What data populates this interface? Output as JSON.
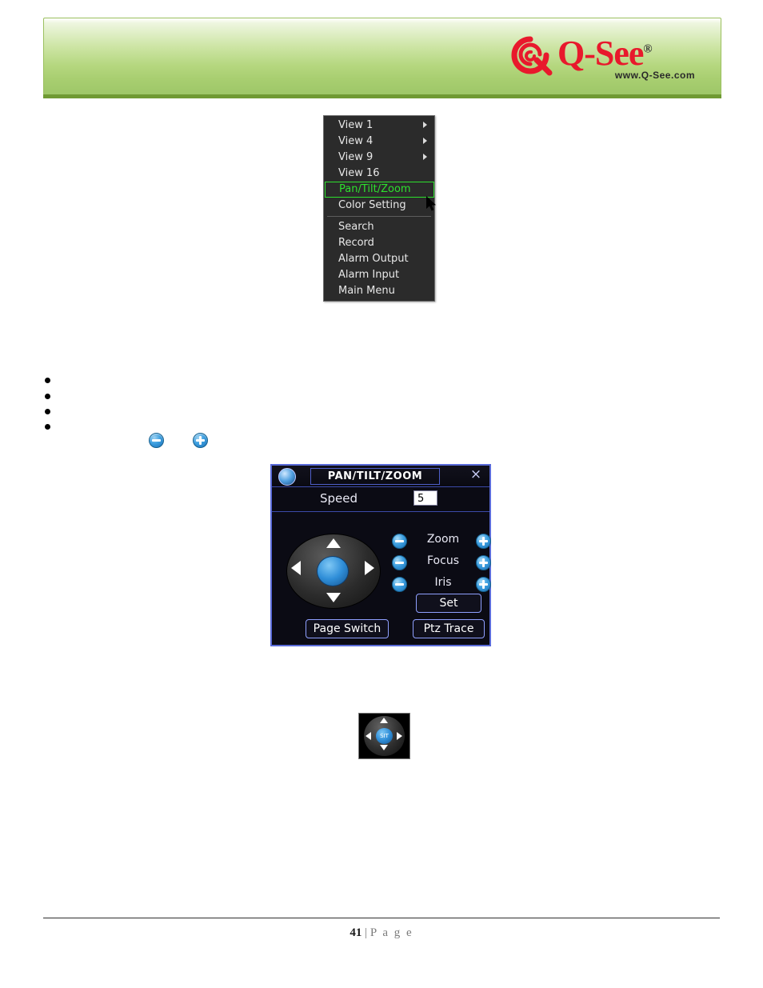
{
  "header": {
    "logo_text": "Q-See",
    "logo_registered": "®",
    "logo_url": "www.Q-See.com"
  },
  "context_menu": {
    "items": [
      {
        "label": "View 1",
        "submenu": true,
        "highlighted": false
      },
      {
        "label": "View 4",
        "submenu": true,
        "highlighted": false
      },
      {
        "label": "View 9",
        "submenu": true,
        "highlighted": false
      },
      {
        "label": "View 16",
        "submenu": false,
        "highlighted": false
      },
      {
        "label": "Pan/Tilt/Zoom",
        "submenu": false,
        "highlighted": true
      },
      {
        "label": "Color Setting",
        "submenu": false,
        "highlighted": false
      },
      {
        "label": "Search",
        "submenu": false,
        "highlighted": false
      },
      {
        "label": "Record",
        "submenu": false,
        "highlighted": false
      },
      {
        "label": "Alarm Output",
        "submenu": false,
        "highlighted": false
      },
      {
        "label": "Alarm Input",
        "submenu": false,
        "highlighted": false
      },
      {
        "label": "Main Menu",
        "submenu": false,
        "highlighted": false
      }
    ]
  },
  "ptz_dialog": {
    "title": "PAN/TILT/ZOOM",
    "close_label": "×",
    "speed_label": "Speed",
    "speed_value": "5",
    "controls": [
      {
        "label": "Zoom"
      },
      {
        "label": "Focus"
      },
      {
        "label": "Iris"
      }
    ],
    "set_label": "Set",
    "page_switch_label": "Page Switch",
    "ptz_trace_label": "Ptz Trace"
  },
  "direction_thumbnail": {
    "center_label": "SIT"
  },
  "footer": {
    "page_number": "41",
    "separator": "|",
    "page_word": "P a g e"
  }
}
